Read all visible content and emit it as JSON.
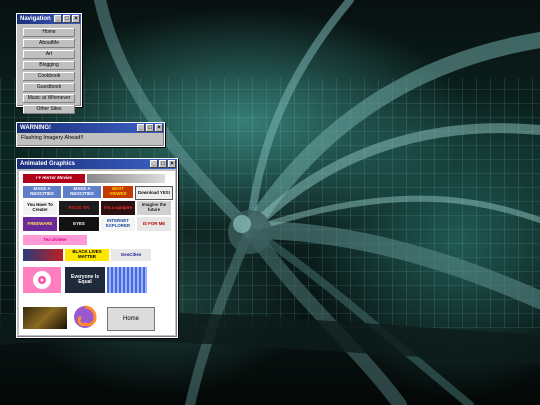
{
  "navigation": {
    "title": "Navigation",
    "items": [
      "Home",
      "AboutMe",
      "Art",
      "Blogging",
      "Cookbook",
      "Guestbook",
      "Music at Whenever",
      "Other Sites"
    ]
  },
  "warning": {
    "title": "WARNING!",
    "message": "Flashing Imagery Ahead!!"
  },
  "graphics": {
    "title": "Animated Graphics",
    "badges": {
      "horror": "I ♥ Horror Movies",
      "mesite1": "MAKE A NEOCITIES",
      "mesite2": "MAKE A NEOCITIES",
      "counter": "BEST VIEWED",
      "download": "Download YES!",
      "youhave": "You Have To Create!",
      "bad": "ROCK ON",
      "vampire": "I'm a vampire",
      "imagine": "Imagine the future",
      "freeware": "FREEWARE",
      "eyes": "EYES",
      "internet": "INTERNET EXPLORER",
      "itunes": "IS FOR ME",
      "teadrinker": "Tea drinker",
      "blm": "BLACK LIVES MATTER",
      "geocities": "GeoCities",
      "equal": "Everyone Is Equal",
      "home": "Home"
    }
  },
  "window_buttons": {
    "min": "_",
    "max": "□",
    "close": "×"
  }
}
